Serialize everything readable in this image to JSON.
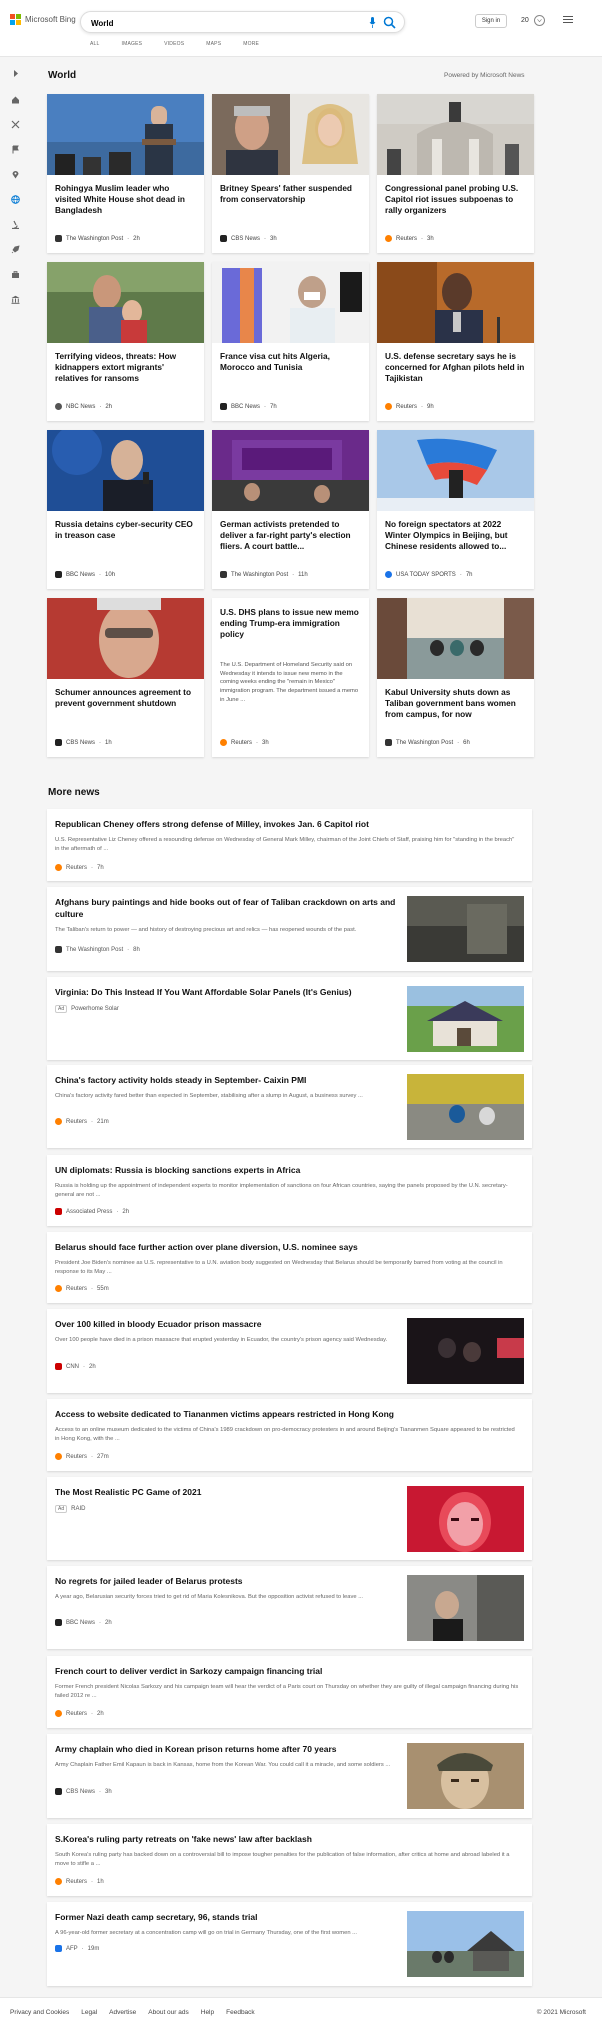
{
  "header": {
    "brand": "Microsoft Bing",
    "search_value": "World",
    "tabs": [
      "ALL",
      "IMAGES",
      "VIDEOS",
      "MAPS",
      "MORE"
    ],
    "signin_label": "Sign in",
    "points": "20",
    "colors": {
      "accent": "#0078d4",
      "ms_red": "#f25022",
      "ms_green": "#7fba00",
      "ms_blue": "#00a4ef",
      "ms_yellow": "#ffb900"
    }
  },
  "rail_icons": [
    "expand-arrow-icon",
    "home-icon",
    "crossed-arrows-icon",
    "flag-icon",
    "map-pin-icon",
    "globe-icon",
    "microscope-icon",
    "rocket-icon",
    "briefcase-icon",
    "bank-icon"
  ],
  "section": {
    "title": "World",
    "powered_by": "Powered by Microsoft News"
  },
  "cards": [
    {
      "title": "Rohingya Muslim leader who visited White House shot dead in Bangladesh",
      "source": "The Washington Post",
      "age": "2h",
      "src_color": "#333333"
    },
    {
      "title": "Britney Spears' father suspended from conservatorship",
      "source": "CBS News",
      "age": "3h",
      "src_color": "#222222"
    },
    {
      "title": "Congressional panel probing U.S. Capitol riot issues subpoenas to rally organizers",
      "source": "Reuters",
      "age": "3h",
      "src_color": "#ff8000"
    },
    {
      "title": "Terrifying videos, threats: How kidnappers extort migrants' relatives for ransoms",
      "source": "NBC News",
      "age": "2h",
      "src_color": "#555555"
    },
    {
      "title": "France visa cut hits Algeria, Morocco and Tunisia",
      "source": "BBC News",
      "age": "7h",
      "src_color": "#222222"
    },
    {
      "title": "U.S. defense secretary says he is concerned for Afghan pilots held in Tajikistan",
      "source": "Reuters",
      "age": "9h",
      "src_color": "#ff8000"
    },
    {
      "title": "Russia detains cyber-security CEO in treason case",
      "source": "BBC News",
      "age": "10h",
      "src_color": "#222222"
    },
    {
      "title": "German activists pretended to deliver a far-right party's election fliers. A court battle...",
      "source": "The Washington Post",
      "age": "11h",
      "src_color": "#333333"
    },
    {
      "title": "No foreign spectators at 2022 Winter Olympics in Beijing, but Chinese residents allowed to...",
      "source": "USA TODAY SPORTS",
      "age": "7h",
      "src_color": "#1a73e8"
    },
    {
      "title": "Schumer announces agreement to prevent government shutdown",
      "source": "CBS News",
      "age": "1h",
      "src_color": "#222222"
    },
    {
      "title": "U.S. DHS plans to issue new memo ending Trump-era immigration policy",
      "source": "Reuters",
      "age": "3h",
      "src_color": "#ff8000",
      "body": "The U.S. Department of Homeland Security said on Wednesday it intends to issue new memo in the coming weeks ending the \"remain in Mexico\" immigration program. The department issued a memo in June ..."
    },
    {
      "title": "Kabul University shuts down as Taliban government bans women from campus, for now",
      "source": "The Washington Post",
      "age": "6h",
      "src_color": "#333333"
    }
  ],
  "more_news_title": "More news",
  "news": [
    {
      "title": "Republican Cheney offers strong defense of Milley, invokes Jan. 6 Capitol riot",
      "body": "U.S. Representative Liz Cheney offered a resounding defense on Wednesday of General Mark Milley, chairman of the Joint Chiefs of Staff, praising him for \"standing in the breach\" in the aftermath of ...",
      "source": "Reuters",
      "age": "7h",
      "src_color": "#ff8000"
    },
    {
      "title": "Afghans bury paintings and hide books out of fear of Taliban crackdown on arts and culture",
      "body": "The Taliban's return to power — and history of destroying precious art and relics — has reopened wounds of the past.",
      "source": "The Washington Post",
      "age": "8h",
      "src_color": "#333333"
    },
    {
      "title": "Virginia: Do This Instead If You Want Affordable Solar Panels (It's Genius)",
      "ad": "Ad",
      "source": "Powerhome Solar",
      "src_color": "#ffffff"
    },
    {
      "title": "China's factory activity holds steady in September- Caixin PMI",
      "body": "China's factory activity fared better than expected in September, stabilising after a slump in August, a business survey ...",
      "source": "Reuters",
      "age": "21m",
      "src_color": "#ff8000"
    },
    {
      "title": "UN diplomats: Russia is blocking sanctions experts in Africa",
      "body": "Russia is holding up the appointment of independent experts to monitor implementation of sanctions on four African countries, saying the panels proposed by the U.N. secretary-general are not ...",
      "source": "Associated Press",
      "age": "2h",
      "src_color": "#cc0000"
    },
    {
      "title": "Belarus should face further action over plane diversion, U.S. nominee says",
      "body": "President Joe Biden's nominee as U.S. representative to a U.N. aviation body suggested on Wednesday that Belarus should be temporarily barred from voting at the council in response to its May ...",
      "source": "Reuters",
      "age": "55m",
      "src_color": "#ff8000"
    },
    {
      "title": "Over 100 killed in bloody Ecuador prison massacre",
      "body": "Over 100 people have died in a prison massacre that erupted yesterday in Ecuador, the country's prison agency said Wednesday.",
      "source": "CNN",
      "age": "2h",
      "src_color": "#cc0000"
    },
    {
      "title": "Access to website dedicated to Tiananmen victims appears restricted in Hong Kong",
      "body": "Access to an online museum dedicated to the victims of China's 1989 crackdown on pro-democracy protesters in and around Beijing's Tiananmen Square appeared to be restricted in Hong Kong, with the ...",
      "source": "Reuters",
      "age": "27m",
      "src_color": "#ff8000"
    },
    {
      "title": "The Most Realistic PC Game of 2021",
      "ad": "Ad",
      "source": "RAID",
      "src_color": "#ffffff"
    },
    {
      "title": "No regrets for jailed leader of Belarus protests",
      "body": "A year ago, Belarusian security forces tried to get rid of Maria Kolesnikova. But the opposition activist refused to leave ...",
      "source": "BBC News",
      "age": "2h",
      "src_color": "#222222"
    },
    {
      "title": "French court to deliver verdict in Sarkozy campaign financing trial",
      "body": "Former French president Nicolas Sarkozy and his campaign team will hear the verdict of a Paris court on Thursday on whether they are guilty of illegal campaign financing during his failed 2012 re ...",
      "source": "Reuters",
      "age": "2h",
      "src_color": "#ff8000"
    },
    {
      "title": "Army chaplain who died in Korean prison returns home after 70 years",
      "body": "Army Chaplain Father Emil Kapaun is back in Kansas, home from the Korean War. You could call it a miracle, and some soldiers ...",
      "source": "CBS News",
      "age": "3h",
      "src_color": "#222222"
    },
    {
      "title": "S.Korea's ruling party retreats on 'fake news' law after backlash",
      "body": "South Korea's ruling party has backed down on a controversial bill to impose tougher penalties for the publication of false information, after critics at home and abroad labeled it a move to stifle a ...",
      "source": "Reuters",
      "age": "1h",
      "src_color": "#ff8000"
    },
    {
      "title": "Former Nazi death camp secretary, 96, stands trial",
      "body": "A 96-year-old former secretary at a concentration camp will go on trial in Germany Thursday, one of the first women ...",
      "source": "AFP",
      "age": "19m",
      "src_color": "#1a73e8"
    }
  ],
  "footer": {
    "links": [
      "Privacy and Cookies",
      "Legal",
      "Advertise",
      "About our ads",
      "Help",
      "Feedback"
    ],
    "copyright": "© 2021 Microsoft"
  }
}
